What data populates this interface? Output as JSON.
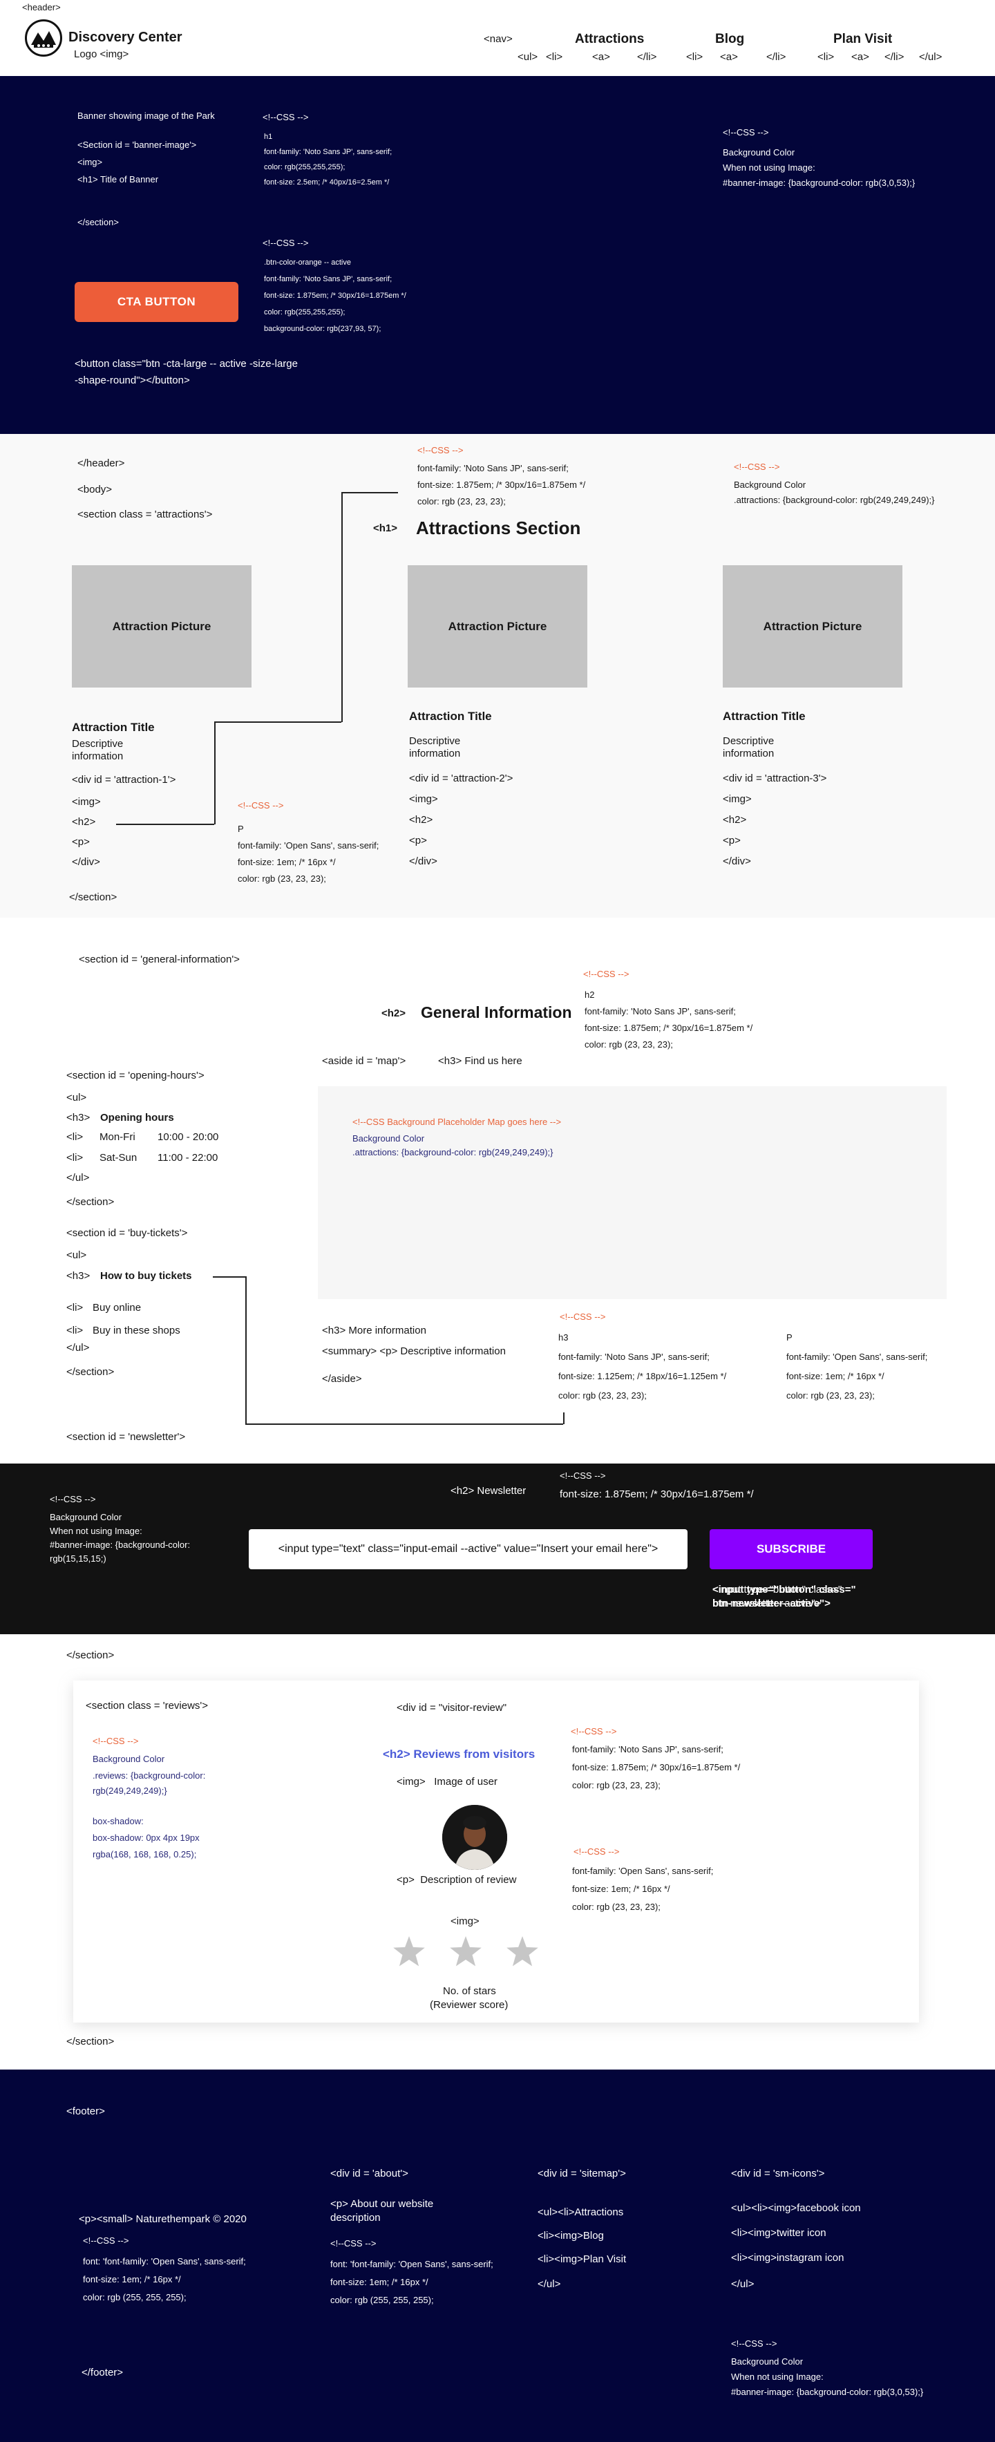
{
  "header": {
    "tag": "<header>",
    "logo_name": "Discovery Center",
    "logo_img": "Logo <img>",
    "nav_tag": "<nav>",
    "nav_items": [
      "Attractions",
      "Blog",
      "Plan Visit"
    ],
    "ul_open": "<ul>",
    "ul_close": "</ul>",
    "li_open": "<li>",
    "li_close": "</li>",
    "a_tag": "<a>"
  },
  "banner": {
    "desc": "Banner showing image of the Park",
    "section_tag": "<Section id = 'banner-image'>",
    "img_tag": "<img>",
    "h1_tag": "<h1> Title of Banner",
    "section_close": "</section>",
    "css_h1": {
      "marker": "<!--CSS -->",
      "lines": [
        "h1",
        "font-family: 'Noto Sans JP', sans-serif;",
        "color: rgb(255,255,255);",
        "font-size: 2.5em; /* 40px/16=2.5em */"
      ]
    },
    "css_btn": {
      "marker": "<!--CSS -->",
      "lines": [
        ".btn-color-orange -- active",
        "font-family: 'Noto Sans JP', sans-serif;",
        "font-size: 1.875em; /* 30px/16=1.875em */",
        "color: rgb(255,255,255);",
        "background-color: rgb(237,93, 57);"
      ]
    },
    "css_bg": {
      "marker": "<!--CSS -->",
      "lines": [
        "Background Color",
        "When not using Image:",
        "#banner-image: {background-color: rgb(3,0,53);}"
      ]
    },
    "cta_label": "CTA BUTTON",
    "button_code": [
      "<button class=\"btn -cta-large -- active -size-large",
      "-shape-round\"></button>"
    ]
  },
  "attractions": {
    "header_close": "</header>",
    "body_tag": "<body>",
    "section_tag": "<section class = 'attractions'>",
    "h1_label": "<h1>",
    "title": "Attractions Section",
    "css_h1": {
      "marker": "<!--CSS -->",
      "lines": [
        "font-family: 'Noto Sans JP', sans-serif;",
        "font-size: 1.875em; /* 30px/16=1.875em */",
        "color: rgb (23, 23, 23);"
      ]
    },
    "css_bg": {
      "marker": "<!--CSS -->",
      "lines": [
        "Background Color",
        ".attractions: {background-color: rgb(249,249,249);}"
      ]
    },
    "css_p": {
      "marker": "<!--CSS -->",
      "lines": [
        "P",
        "font-family: 'Open Sans', sans-serif;",
        "font-size: 1em; /* 16px */",
        "color: rgb (23, 23, 23);"
      ]
    },
    "cards": [
      {
        "picture": "Attraction Picture",
        "title": "Attraction Title",
        "desc1": "Descriptive",
        "desc2": "information",
        "div": "<div id = 'attraction-1'>",
        "img": "<img>",
        "h2": "<h2>",
        "p": "<p>",
        "close": "</div>"
      },
      {
        "picture": "Attraction Picture",
        "title": "Attraction Title",
        "desc1": "Descriptive",
        "desc2": "information",
        "div": "<div id = 'attraction-2'>",
        "img": "<img>",
        "h2": "<h2>",
        "p": "<p>",
        "close": "</div>"
      },
      {
        "picture": "Attraction Picture",
        "title": "Attraction Title",
        "desc1": "Descriptive",
        "desc2": "information",
        "div": "<div id = 'attraction-3'>",
        "img": "<img>",
        "h2": "<h2>",
        "p": "<p>",
        "close": "</div>"
      }
    ],
    "section_close": "</section>"
  },
  "general": {
    "section_tag": "<section id = 'general-information'>",
    "h2_label": "<h2>",
    "title": "General Information",
    "css_h2": {
      "marker": "<!--CSS -->",
      "lines": [
        "h2",
        "font-family: 'Noto Sans JP', sans-serif;",
        "font-size: 1.875em; /* 30px/16=1.875em */",
        "color: rgb (23, 23, 23);"
      ]
    },
    "aside_tag": "<aside id = 'map'>",
    "h3_find": "<h3> Find us here",
    "map_css": "<!--CSS Background Placeholder Map goes here -->",
    "map_bg": [
      "Background Color",
      ".attractions: {background-color: rgb(249,249,249);}"
    ],
    "opening": {
      "section": "<section id = 'opening-hours'>",
      "ul": "<ul>",
      "h3": "<h3>",
      "title": "Opening hours",
      "li": "<li>",
      "rows": [
        [
          "Mon-Fri",
          "10:00 - 20:00"
        ],
        [
          "Sat-Sun",
          "11:00 - 22:00"
        ]
      ],
      "ul_close": "</ul>",
      "section_close": "</section>"
    },
    "tickets": {
      "section": "<section id = 'buy-tickets'>",
      "ul": "<ul>",
      "h3": "<h3>",
      "title": "How to buy tickets",
      "li": "<li>",
      "items": [
        "Buy online",
        "Buy in these shops"
      ],
      "ul_close": "</ul>",
      "section_close": "</section>"
    },
    "more": [
      "<h3> More information",
      "<summary> <p> Descriptive information",
      "</aside>"
    ],
    "css_h3": {
      "marker": "<!--CSS -->",
      "lines": [
        "h3",
        "font-family: 'Noto Sans JP', sans-serif;",
        "font-size: 1.125em; /* 18px/16=1.125em */",
        "color: rgb (23, 23, 23);"
      ]
    },
    "css_p": {
      "lines": [
        "P",
        "font-family: 'Open Sans', sans-serif;",
        "font-size: 1em; /* 16px */",
        "color: rgb (23, 23, 23);"
      ]
    },
    "newsletter_section": "<section id = 'newsletter'>"
  },
  "newsletter": {
    "css_bg": {
      "marker": "<!--CSS -->",
      "lines": [
        "Background Color",
        "When not using Image:",
        "#banner-image: {background-color:",
        "rgb(15,15,15;)"
      ]
    },
    "h2": "<h2> Newsletter",
    "css_h2": {
      "marker": "<!--CSS -->",
      "line": "font-size: 1.875em; /* 30px/16=1.875em */"
    },
    "input_value": "<input type=\"text\" class=\"input-email --active\" value=\"Insert your email here\">",
    "subscribe": "SUBSCRIBE",
    "btn_code": [
      "<input type=\"button\" class=\"",
      "btn-newsletter--active\">"
    ],
    "section_close": "</section>"
  },
  "reviews": {
    "section_tag": "<section class = 'reviews'>",
    "css_bg": {
      "marker": "<!--CSS -->",
      "lines": [
        "Background Color",
        ".reviews: {background-color:",
        "rgb(249,249,249);}",
        "",
        "box-shadow:",
        "box-shadow: 0px 4px 19px",
        "rgba(168, 168, 168, 0.25);"
      ]
    },
    "div_tag": "<div id = \"visitor-review\"",
    "h2_code": "<h2> Reviews from visitors",
    "img_user": "<img>   Image of user",
    "p_desc": "<p>  Description of review",
    "img_tag": "<img>",
    "stars_label": [
      "No. of stars",
      "(Reviewer score)"
    ],
    "stars": 3,
    "css_h2": {
      "marker": "<!--CSS -->",
      "lines": [
        "font-family: 'Noto Sans JP', sans-serif;",
        "font-size: 1.875em; /* 30px/16=1.875em */",
        "color: rgb (23, 23, 23);"
      ]
    },
    "css_p": {
      "marker": "<!--CSS -->",
      "lines": [
        "font-family: 'Open Sans', sans-serif;",
        "font-size: 1em; /* 16px */",
        "color: rgb (23, 23, 23);"
      ]
    },
    "section_close": "</section>"
  },
  "footer": {
    "tag": "<footer>",
    "copyright": "<p><small> Naturethempark © 2020",
    "css1": {
      "marker": "<!--CSS -->",
      "lines": [
        "font: 'font-family: 'Open Sans', sans-serif;",
        "font-size: 1em; /* 16px */",
        "color: rgb (255, 255, 255);"
      ]
    },
    "about": [
      "<div id = 'about'>",
      "<p> About our website",
      "description"
    ],
    "css2": {
      "marker": "<!--CSS -->",
      "lines": [
        "font: 'font-family: 'Open Sans', sans-serif;",
        "font-size: 1em; /* 16px */",
        "color: rgb (255, 255, 255);"
      ]
    },
    "sitemap": [
      "<div id = 'sitemap'>",
      "<ul><li>Attractions",
      "<li><img>Blog",
      "<li><img>Plan Visit",
      "</ul>"
    ],
    "icons": [
      "<div id = 'sm-icons'>",
      "<ul><li><img>facebook icon",
      "<li><img>twitter icon",
      "<li><img>instagram icon",
      "</ul>"
    ],
    "css_bg": {
      "marker": "<!--CSS -->",
      "lines": [
        "Background Color",
        "When not using Image:",
        "#banner-image: {background-color: rgb(3,0,53);}"
      ]
    },
    "close": "</footer>"
  },
  "colors": {
    "banner_bg": "#03053a",
    "cta": "#ed5d39",
    "attractions_bg": "#f9f9f9",
    "newsletter_bg": "#121212",
    "subscribe": "#8a00ff",
    "review_heading": "#4a5bd8",
    "css_marker": "#e8643a"
  }
}
